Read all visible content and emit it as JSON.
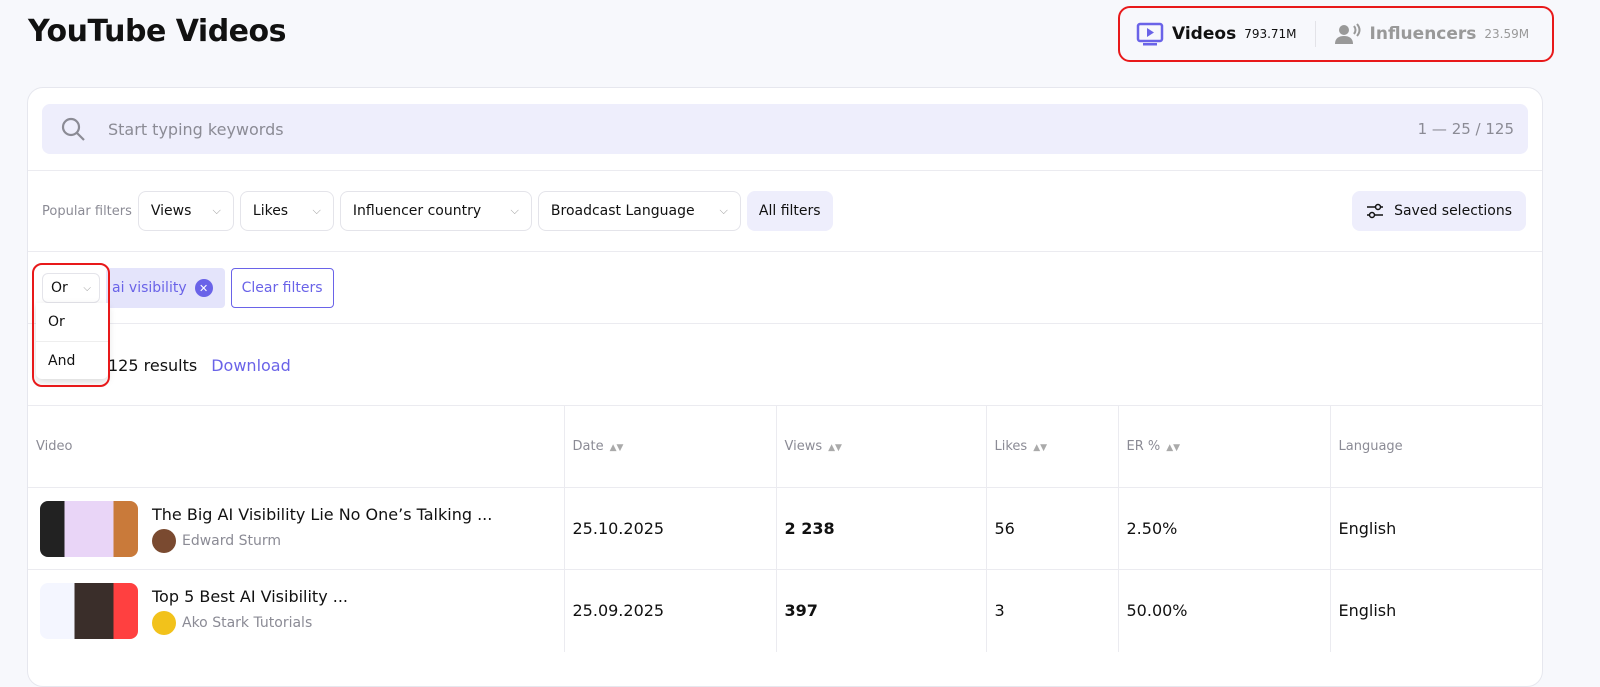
{
  "header": {
    "title": "YouTube Videos"
  },
  "switcher": {
    "videos": {
      "label": "Videos",
      "count": "793.71M",
      "icon": "video-play-icon"
    },
    "influencers": {
      "label": "Influencers",
      "count": "23.59M",
      "icon": "influencer-speaking-icon"
    }
  },
  "search": {
    "placeholder": "Start typing keywords",
    "pagination": "1 — 25 / 125"
  },
  "filters": {
    "label": "Popular filters",
    "items": [
      "Views",
      "Likes",
      "Influencer country",
      "Broadcast Language"
    ],
    "all": "All filters",
    "saved": "Saved selections"
  },
  "chips": {
    "operator": "Or",
    "operator_options": [
      "Or",
      "And"
    ],
    "keyword": "ai visibility",
    "clear": "Clear filters"
  },
  "results": {
    "count": "125 results",
    "download": "Download"
  },
  "table": {
    "columns": [
      "Video",
      "Date",
      "Views",
      "Likes",
      "ER %",
      "Language"
    ],
    "rows": [
      {
        "title": "The Big AI Visibility Lie No One’s Talking ...",
        "channel": "Edward Sturm",
        "date": "25.10.2025",
        "views": "2 238",
        "likes": "56",
        "er": "2.50%",
        "language": "English"
      },
      {
        "title": "Top 5 Best AI Visibility ...",
        "channel": "Ako Stark Tutorials",
        "date": "25.09.2025",
        "views": "397",
        "likes": "3",
        "er": "50.00%",
        "language": "English"
      }
    ]
  },
  "colors": {
    "accent": "#6a63e8",
    "highlight": "#e8191a"
  }
}
